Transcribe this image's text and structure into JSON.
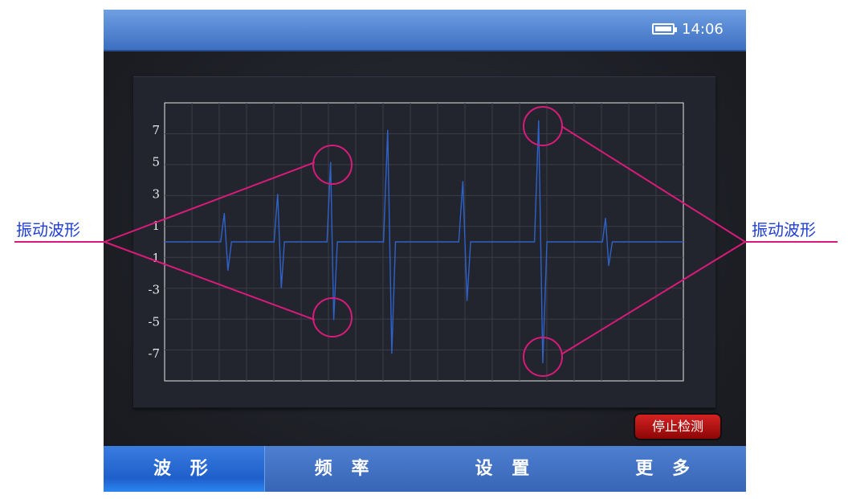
{
  "status": {
    "time": "14:06",
    "battery_icon": "battery-full-icon"
  },
  "chart_data": {
    "type": "line",
    "yticks": [
      7,
      5,
      3,
      1,
      -1,
      -3,
      -5,
      -7
    ],
    "ylim": [
      -8.7,
      8.7
    ],
    "xlim": [
      0,
      100
    ],
    "grid": true,
    "series": [
      {
        "color": "#2f62c8",
        "points": [
          [
            0,
            0
          ],
          [
            10.8,
            0
          ],
          [
            11.5,
            1.8
          ],
          [
            12.2,
            -1.8
          ],
          [
            12.9,
            0
          ],
          [
            21.1,
            0
          ],
          [
            21.8,
            3.0
          ],
          [
            22.5,
            -2.9
          ],
          [
            23.1,
            0
          ],
          [
            31.3,
            0
          ],
          [
            32.0,
            5.0
          ],
          [
            32.6,
            -4.9
          ],
          [
            33.3,
            0
          ],
          [
            42.2,
            0
          ],
          [
            43.0,
            7.0
          ],
          [
            43.8,
            -7.0
          ],
          [
            44.5,
            0
          ],
          [
            56.7,
            0
          ],
          [
            57.5,
            3.8
          ],
          [
            58.3,
            -3.7
          ],
          [
            59.0,
            0
          ],
          [
            71.3,
            0
          ],
          [
            72.1,
            7.6
          ],
          [
            72.9,
            -7.6
          ],
          [
            73.7,
            0
          ],
          [
            84.4,
            0
          ],
          [
            85.0,
            1.5
          ],
          [
            85.6,
            -1.5
          ],
          [
            86.3,
            0
          ],
          [
            100,
            0
          ]
        ]
      }
    ]
  },
  "actions": {
    "stop_label": "停止检测"
  },
  "tabs": [
    {
      "label": "波 形",
      "active": true
    },
    {
      "label": "频 率",
      "active": false
    },
    {
      "label": "设 置",
      "active": false
    },
    {
      "label": "更 多",
      "active": false
    }
  ],
  "callouts": {
    "left_label": "振动波形",
    "right_label": "振动波形",
    "color": "#d81b7a"
  }
}
